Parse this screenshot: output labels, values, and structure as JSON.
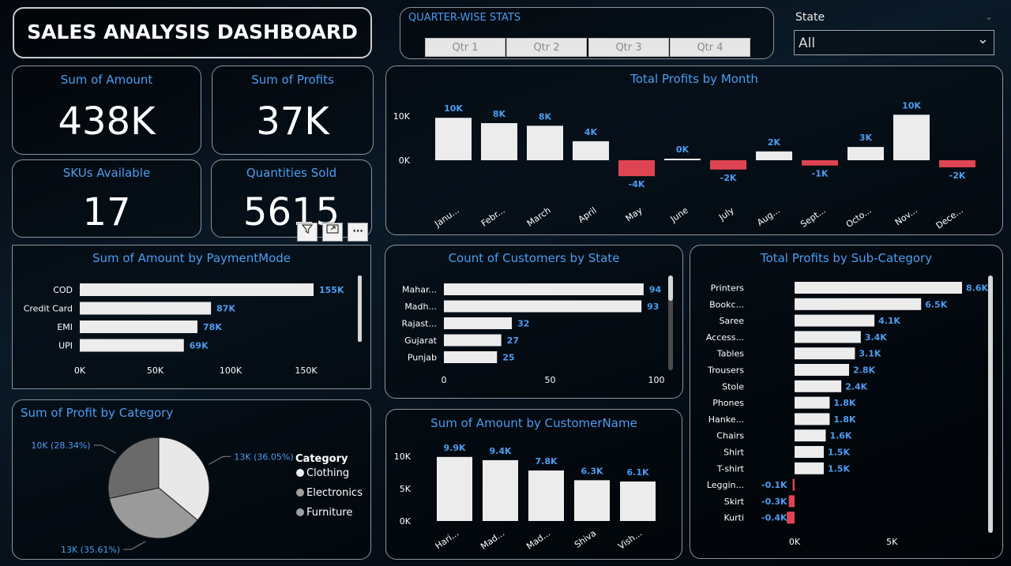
{
  "header": {
    "title": "SALES ANALYSIS DASHBOARD"
  },
  "quarter_slicer": {
    "title": "QUARTER-WISE STATS",
    "buttons": [
      "Qtr 1",
      "Qtr 2",
      "Qtr 3",
      "Qtr 4"
    ]
  },
  "state_filter": {
    "label": "State",
    "value": "All"
  },
  "kpis": [
    {
      "label": "Sum of Amount",
      "value": "438K"
    },
    {
      "label": "Sum of Profits",
      "value": "37K"
    },
    {
      "label": "SKUs Available",
      "value": "17"
    },
    {
      "label": "Quantities Sold",
      "value": "5615"
    }
  ],
  "colors": {
    "accent": "#4d9cf0",
    "positive": "#ececec",
    "negative": "#e04452",
    "panel_border": "#8a949e"
  },
  "visual_toolbar": {
    "icons": [
      "filter-icon",
      "focus-mode-icon",
      "more-options-icon"
    ]
  },
  "chart_data": [
    {
      "id": "profits_by_month",
      "type": "bar",
      "title": "Total Profits by Month",
      "categories": [
        "Janu...",
        "Febr...",
        "March",
        "April",
        "May",
        "June",
        "July",
        "Aug...",
        "Sept...",
        "Octo...",
        "Nov...",
        "Dece..."
      ],
      "values": [
        9.6,
        8.4,
        7.8,
        4.3,
        -3.6,
        0.2,
        -2.1,
        2.0,
        -1.2,
        3.0,
        10.3,
        -1.6
      ],
      "data_labels": [
        "10K",
        "8K",
        "8K",
        "4K",
        "-4K",
        "0K",
        "-2K",
        "2K",
        "-1K",
        "3K",
        "10K",
        "-2K"
      ],
      "y_ticks": [
        "10K",
        "0K"
      ],
      "ylim": [
        -5,
        12
      ],
      "grid": false
    },
    {
      "id": "amount_by_paymentmode",
      "type": "bar",
      "orientation": "horizontal",
      "title": "Sum of Amount by PaymentMode",
      "categories": [
        "COD",
        "Credit Card",
        "EMI",
        "UPI"
      ],
      "values": [
        155,
        87,
        78,
        69
      ],
      "data_labels": [
        "155K",
        "87K",
        "78K",
        "69K"
      ],
      "x_ticks": [
        "0K",
        "50K",
        "100K",
        "150K"
      ],
      "xlim": [
        0,
        175
      ]
    },
    {
      "id": "customers_by_state",
      "type": "bar",
      "orientation": "horizontal",
      "title": "Count of Customers by State",
      "categories": [
        "Mahar...",
        "Madh...",
        "Rajast...",
        "Gujarat",
        "Punjab"
      ],
      "values": [
        94,
        93,
        32,
        27,
        25
      ],
      "data_labels": [
        "94",
        "93",
        "32",
        "27",
        "25"
      ],
      "x_ticks": [
        "0",
        "50",
        "100"
      ],
      "xlim": [
        0,
        100
      ]
    },
    {
      "id": "profits_by_subcategory",
      "type": "bar",
      "orientation": "horizontal",
      "title": "Total Profits by Sub-Category",
      "categories": [
        "Printers",
        "Bookc...",
        "Saree",
        "Access...",
        "Tables",
        "Trousers",
        "Stole",
        "Phones",
        "Hanke...",
        "Chairs",
        "Shirt",
        "T-shirt",
        "Leggin...",
        "Skirt",
        "Kurti"
      ],
      "values": [
        8.6,
        6.5,
        4.1,
        3.4,
        3.1,
        2.8,
        2.4,
        1.8,
        1.8,
        1.6,
        1.5,
        1.5,
        -0.1,
        -0.3,
        -0.4
      ],
      "data_labels": [
        "8.6K",
        "6.5K",
        "4.1K",
        "3.4K",
        "3.1K",
        "2.8K",
        "2.4K",
        "1.8K",
        "1.8K",
        "1.6K",
        "1.5K",
        "1.5K",
        "-0.1K",
        "-0.3K",
        "-0.4K"
      ],
      "x_ticks": [
        "0K",
        "5K"
      ],
      "xlim": [
        -0.4,
        8.6
      ]
    },
    {
      "id": "profit_by_category",
      "type": "pie",
      "title": "Sum of Profit by Category",
      "legend_title": "Category",
      "labels": [
        "Clothing",
        "Electronics",
        "Furniture"
      ],
      "values": [
        36.05,
        35.61,
        28.34
      ],
      "slice_labels": [
        "13K (36.05%)",
        "13K (35.61%)",
        "10K (28.34%)"
      ],
      "colors": [
        "#e8e8e8",
        "#9a9a9a",
        "#6a6a6a"
      ],
      "legend_position": "right"
    },
    {
      "id": "amount_by_customername",
      "type": "bar",
      "title": "Sum of Amount by CustomerName",
      "categories": [
        "Hari...",
        "Mad...",
        "Mad...",
        "Shiva",
        "Vish..."
      ],
      "values": [
        9.9,
        9.4,
        7.8,
        6.3,
        6.1
      ],
      "data_labels": [
        "9.9K",
        "9.4K",
        "7.8K",
        "6.3K",
        "6.1K"
      ],
      "y_ticks": [
        "10K",
        "5K",
        "0K"
      ],
      "ylim": [
        0,
        10
      ]
    }
  ]
}
